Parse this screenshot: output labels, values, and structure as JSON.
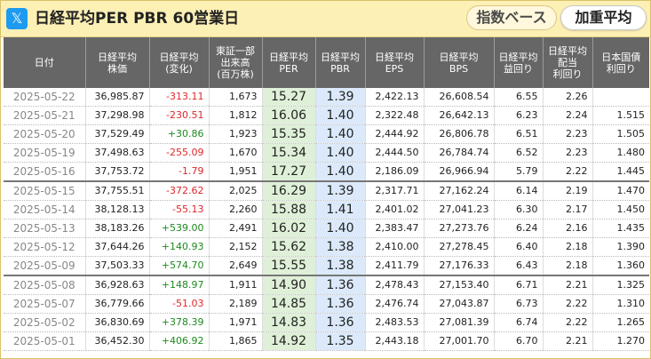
{
  "header": {
    "icon": "x-logo-icon",
    "title": "日経平均PER PBR 60営業日",
    "tabs": [
      {
        "label": "指数ベース",
        "active": false
      },
      {
        "label": "加重平均",
        "active": true
      }
    ]
  },
  "colors": {
    "header_bg": "#fdf0b5",
    "column_header_bg": "#666666",
    "per_bg": "#dff0d8",
    "pbr_bg": "#dbe9fa",
    "positive": "#1e8a1e",
    "negative": "#e0262a"
  },
  "table": {
    "columns": [
      {
        "key": "date",
        "label": "日付"
      },
      {
        "key": "price",
        "label": "日経平均\n株価"
      },
      {
        "key": "change",
        "label": "日経平均\n(変化)"
      },
      {
        "key": "volume",
        "label": "東証一部\n出来高\n(百万株)"
      },
      {
        "key": "per",
        "label": "日経平均\nPER"
      },
      {
        "key": "pbr",
        "label": "日経平均\nPBR"
      },
      {
        "key": "eps",
        "label": "日経平均\nEPS"
      },
      {
        "key": "bps",
        "label": "日経平均\nBPS"
      },
      {
        "key": "earnings_yield",
        "label": "日経平均\n益回り"
      },
      {
        "key": "dividend_yield",
        "label": "日経平均\n配当\n利回り"
      },
      {
        "key": "jgb_yield",
        "label": "日本国債\n利回り"
      }
    ],
    "rows": [
      {
        "date": "2025-05-22",
        "price": "36,985.87",
        "change": "-313.11",
        "volume": "1,673",
        "per": "15.27",
        "pbr": "1.39",
        "eps": "2,422.13",
        "bps": "26,608.54",
        "earnings_yield": "6.55",
        "dividend_yield": "2.26",
        "jgb_yield": "",
        "week_end": false
      },
      {
        "date": "2025-05-21",
        "price": "37,298.98",
        "change": "-230.51",
        "volume": "1,812",
        "per": "16.06",
        "pbr": "1.40",
        "eps": "2,322.48",
        "bps": "26,642.13",
        "earnings_yield": "6.23",
        "dividend_yield": "2.24",
        "jgb_yield": "1.515",
        "week_end": false
      },
      {
        "date": "2025-05-20",
        "price": "37,529.49",
        "change": "+30.86",
        "volume": "1,923",
        "per": "15.35",
        "pbr": "1.40",
        "eps": "2,444.92",
        "bps": "26,806.78",
        "earnings_yield": "6.51",
        "dividend_yield": "2.23",
        "jgb_yield": "1.505",
        "week_end": false
      },
      {
        "date": "2025-05-19",
        "price": "37,498.63",
        "change": "-255.09",
        "volume": "1,670",
        "per": "15.34",
        "pbr": "1.40",
        "eps": "2,444.50",
        "bps": "26,784.74",
        "earnings_yield": "6.52",
        "dividend_yield": "2.23",
        "jgb_yield": "1.480",
        "week_end": false
      },
      {
        "date": "2025-05-16",
        "price": "37,753.72",
        "change": "-1.79",
        "volume": "1,951",
        "per": "17.27",
        "pbr": "1.40",
        "eps": "2,186.09",
        "bps": "26,966.94",
        "earnings_yield": "5.79",
        "dividend_yield": "2.22",
        "jgb_yield": "1.445",
        "week_end": true
      },
      {
        "date": "2025-05-15",
        "price": "37,755.51",
        "change": "-372.62",
        "volume": "2,025",
        "per": "16.29",
        "pbr": "1.39",
        "eps": "2,317.71",
        "bps": "27,162.24",
        "earnings_yield": "6.14",
        "dividend_yield": "2.19",
        "jgb_yield": "1.470",
        "week_end": false
      },
      {
        "date": "2025-05-14",
        "price": "38,128.13",
        "change": "-55.13",
        "volume": "2,260",
        "per": "15.88",
        "pbr": "1.41",
        "eps": "2,401.02",
        "bps": "27,041.23",
        "earnings_yield": "6.30",
        "dividend_yield": "2.17",
        "jgb_yield": "1.450",
        "week_end": false
      },
      {
        "date": "2025-05-13",
        "price": "38,183.26",
        "change": "+539.00",
        "volume": "2,491",
        "per": "16.02",
        "pbr": "1.40",
        "eps": "2,383.47",
        "bps": "27,273.76",
        "earnings_yield": "6.24",
        "dividend_yield": "2.16",
        "jgb_yield": "1.435",
        "week_end": false
      },
      {
        "date": "2025-05-12",
        "price": "37,644.26",
        "change": "+140.93",
        "volume": "2,152",
        "per": "15.62",
        "pbr": "1.38",
        "eps": "2,410.00",
        "bps": "27,278.45",
        "earnings_yield": "6.40",
        "dividend_yield": "2.18",
        "jgb_yield": "1.390",
        "week_end": false
      },
      {
        "date": "2025-05-09",
        "price": "37,503.33",
        "change": "+574.70",
        "volume": "2,649",
        "per": "15.55",
        "pbr": "1.38",
        "eps": "2,411.79",
        "bps": "27,176.33",
        "earnings_yield": "6.43",
        "dividend_yield": "2.18",
        "jgb_yield": "1.360",
        "week_end": true
      },
      {
        "date": "2025-05-08",
        "price": "36,928.63",
        "change": "+148.97",
        "volume": "1,911",
        "per": "14.90",
        "pbr": "1.36",
        "eps": "2,478.43",
        "bps": "27,153.40",
        "earnings_yield": "6.71",
        "dividend_yield": "2.21",
        "jgb_yield": "1.325",
        "week_end": false
      },
      {
        "date": "2025-05-07",
        "price": "36,779.66",
        "change": "-51.03",
        "volume": "2,189",
        "per": "14.85",
        "pbr": "1.36",
        "eps": "2,476.74",
        "bps": "27,043.87",
        "earnings_yield": "6.73",
        "dividend_yield": "2.22",
        "jgb_yield": "1.310",
        "week_end": false
      },
      {
        "date": "2025-05-02",
        "price": "36,830.69",
        "change": "+378.39",
        "volume": "1,971",
        "per": "14.83",
        "pbr": "1.36",
        "eps": "2,483.53",
        "bps": "27,081.39",
        "earnings_yield": "6.74",
        "dividend_yield": "2.22",
        "jgb_yield": "1.265",
        "week_end": false
      },
      {
        "date": "2025-05-01",
        "price": "36,452.30",
        "change": "+406.92",
        "volume": "1,865",
        "per": "14.92",
        "pbr": "1.35",
        "eps": "2,443.18",
        "bps": "27,001.70",
        "earnings_yield": "6.70",
        "dividend_yield": "2.21",
        "jgb_yield": "1.270",
        "week_end": false
      }
    ]
  }
}
